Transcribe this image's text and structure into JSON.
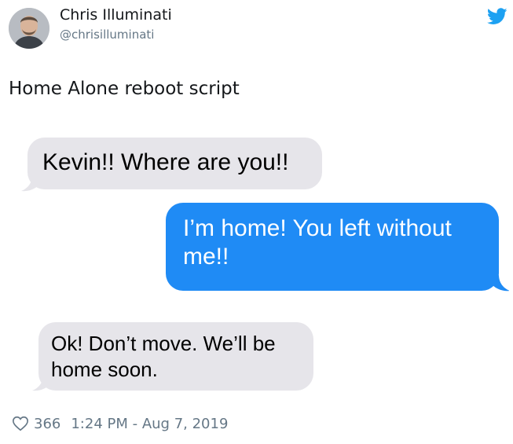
{
  "tweet": {
    "author": {
      "display_name": "Chris Illuminati",
      "handle": "@chrisilluminati",
      "avatar_icon": "avatar"
    },
    "brand_icon": "twitter-bird-icon",
    "brand_color": "#1da1f2",
    "text": "Home Alone reboot script",
    "media": {
      "messages": [
        {
          "direction": "incoming",
          "text": "Kevin!! Where are you!!"
        },
        {
          "direction": "outgoing",
          "text": "I’m home! You left without me!!"
        },
        {
          "direction": "incoming",
          "text": "Ok! Don’t move. We’ll be home soon."
        }
      ],
      "incoming_color": "#e6e5ea",
      "outgoing_color": "#1f8bf5"
    },
    "footer": {
      "like_icon": "heart-icon",
      "likes": "366",
      "timestamp": "1:24 PM - Aug 7, 2019"
    }
  }
}
